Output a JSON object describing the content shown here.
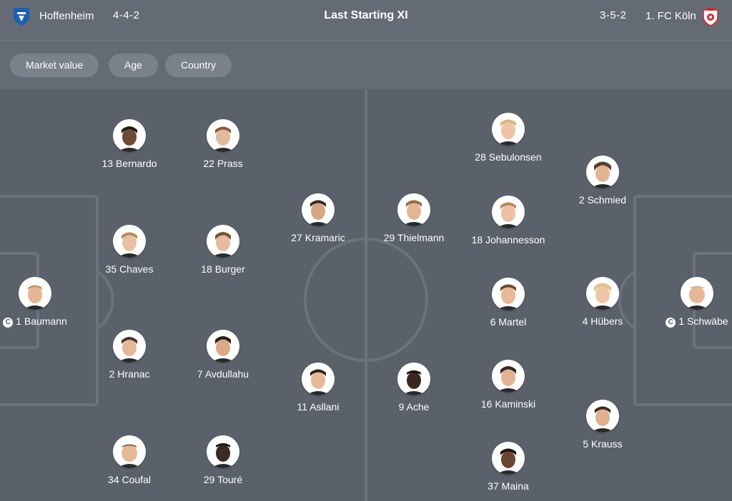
{
  "header": {
    "title": "Last Starting XI",
    "home": {
      "name": "Hoffenheim",
      "formation": "4-4-2",
      "crest_icon": "hoffenheim-crest-icon"
    },
    "away": {
      "name": "1. FC Köln",
      "formation": "3-5-2",
      "crest_icon": "koln-crest-icon"
    }
  },
  "filters": [
    {
      "label": "Market value"
    },
    {
      "label": "Age"
    },
    {
      "label": "Country"
    }
  ],
  "captain_badge": "C",
  "colors": {
    "background": "#646b75",
    "pitch": "#5a616b",
    "lines": "#6c737d",
    "chip": "#7a818b"
  },
  "players": [
    {
      "label": "13 Bernardo"
    },
    {
      "label": "22 Prass"
    },
    {
      "label": "35 Chaves"
    },
    {
      "label": "18 Burger"
    },
    {
      "label": "1 Baumann",
      "captain": true
    },
    {
      "label": "2 Hranac"
    },
    {
      "label": "7 Avdullahu"
    },
    {
      "label": "34 Coufal"
    },
    {
      "label": "29 Touré"
    },
    {
      "label": "27 Kramaric"
    },
    {
      "label": "11 Asllani"
    },
    {
      "label": "29 Thielmann"
    },
    {
      "label": "9 Ache"
    },
    {
      "label": "28 Sebulonsen"
    },
    {
      "label": "18 Johannesson"
    },
    {
      "label": "6 Martel"
    },
    {
      "label": "16 Kaminski"
    },
    {
      "label": "37 Maina"
    },
    {
      "label": "2 Schmied"
    },
    {
      "label": "4 Hübers"
    },
    {
      "label": "5 Krauss"
    },
    {
      "label": "1 Schwäbe",
      "captain": true
    }
  ]
}
